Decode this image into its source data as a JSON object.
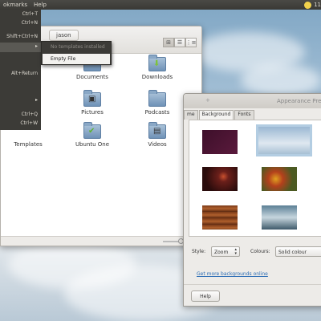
{
  "top_panel": {
    "menus": [
      "okmarks",
      "Help"
    ],
    "clock": "11"
  },
  "app_menu": {
    "shortcuts": [
      "Ctrl+T",
      "Ctrl+N",
      "Shift+Ctrl+N",
      "Alt+Return",
      "Ctrl+Q",
      "Ctrl+W"
    ]
  },
  "submenu": {
    "disabled_label": "No templates installed",
    "empty_file": "Empty File"
  },
  "file_manager": {
    "breadcrumb": "jason",
    "items": [
      {
        "label": "Documents",
        "emblem": ""
      },
      {
        "label": "Downloads",
        "emblem": "download"
      },
      {
        "label": "Pictures",
        "emblem": "camera"
      },
      {
        "label": "Podcasts",
        "emblem": ""
      },
      {
        "label": "Templates",
        "emblem": ""
      },
      {
        "label": "Ubuntu One",
        "emblem": "check"
      },
      {
        "label": "Videos",
        "emblem": "film"
      }
    ]
  },
  "appearance": {
    "title": "Appearance Prefer",
    "tabs": [
      "me",
      "Background",
      "Fonts"
    ],
    "style_label": "Style:",
    "style_value": "Zoom",
    "colours_label": "Colours:",
    "colours_value": "Solid colour",
    "link": "Get more backgrounds online",
    "help": "Help"
  }
}
